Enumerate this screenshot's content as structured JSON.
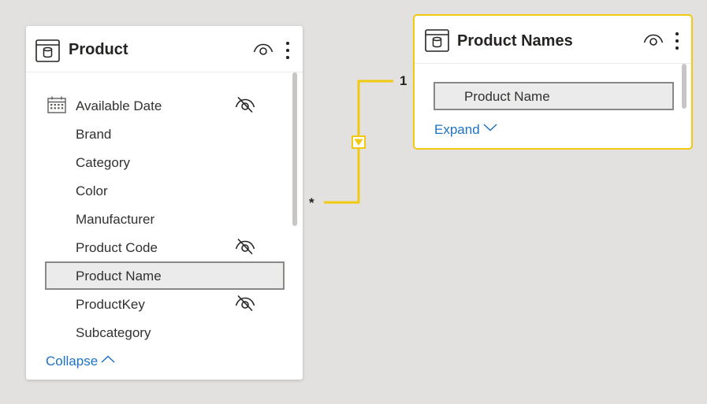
{
  "colors": {
    "relationship_line": "#f2c811",
    "link": "#1e72c1",
    "canvas": "#e2e1df"
  },
  "product_table": {
    "title": "Product",
    "icon": "table-icon",
    "fields": [
      {
        "label": "Available Date",
        "icon": "calendar-icon",
        "hidden": true,
        "selected": false
      },
      {
        "label": "Brand",
        "icon": null,
        "hidden": false,
        "selected": false
      },
      {
        "label": "Category",
        "icon": null,
        "hidden": false,
        "selected": false
      },
      {
        "label": "Color",
        "icon": null,
        "hidden": false,
        "selected": false
      },
      {
        "label": "Manufacturer",
        "icon": null,
        "hidden": false,
        "selected": false
      },
      {
        "label": "Product Code",
        "icon": null,
        "hidden": true,
        "selected": false
      },
      {
        "label": "Product Name",
        "icon": null,
        "hidden": false,
        "selected": true
      },
      {
        "label": "ProductKey",
        "icon": null,
        "hidden": true,
        "selected": false
      },
      {
        "label": "Subcategory",
        "icon": null,
        "hidden": false,
        "selected": false
      }
    ],
    "collapse_label": "Collapse"
  },
  "product_names_table": {
    "title": "Product Names",
    "icon": "table-icon",
    "fields": [
      {
        "label": "Product Name",
        "selected": true
      }
    ],
    "expand_label": "Expand",
    "selected": true
  },
  "relationship": {
    "many_label": "*",
    "one_label": "1",
    "filter_direction": "single"
  }
}
